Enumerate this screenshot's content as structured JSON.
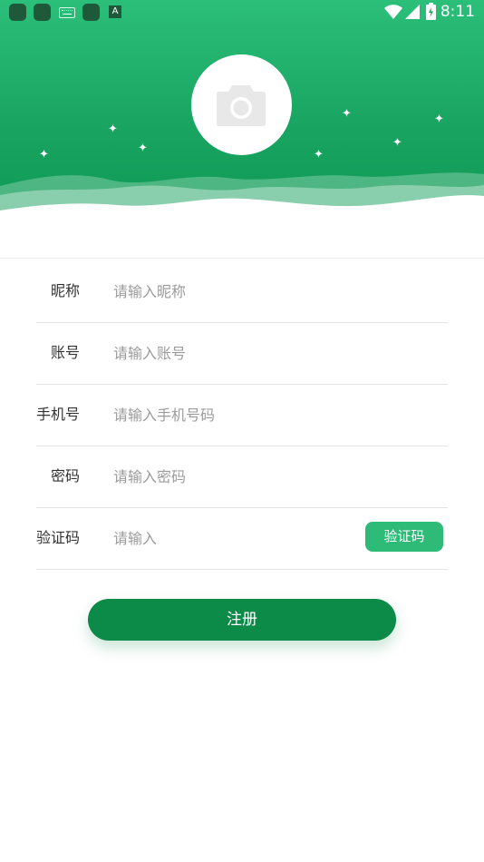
{
  "status_bar": {
    "time": "8:11",
    "icons": [
      "app-icon",
      "app-icon",
      "keyboard-icon",
      "app-icon",
      "a-icon",
      "wifi-icon",
      "signal-icon",
      "battery-icon"
    ],
    "a_glyph": "A"
  },
  "header": {
    "avatar_icon": "camera-icon",
    "gradient_colors": [
      "#2bbf79",
      "#0e9a55"
    ]
  },
  "form": {
    "nickname": {
      "label": "昵称",
      "placeholder": "请输入昵称"
    },
    "account": {
      "label": "账号",
      "placeholder": "请输入账号"
    },
    "phone": {
      "label": "手机号",
      "placeholder": "请输入手机号码"
    },
    "password": {
      "label": "密码",
      "placeholder": "请输入密码"
    },
    "verify": {
      "label": "验证码",
      "placeholder": "请输入",
      "button": "验证码"
    }
  },
  "register_button": "注册",
  "colors": {
    "accent": "#2dbb77",
    "primary": "#0c8a48"
  }
}
